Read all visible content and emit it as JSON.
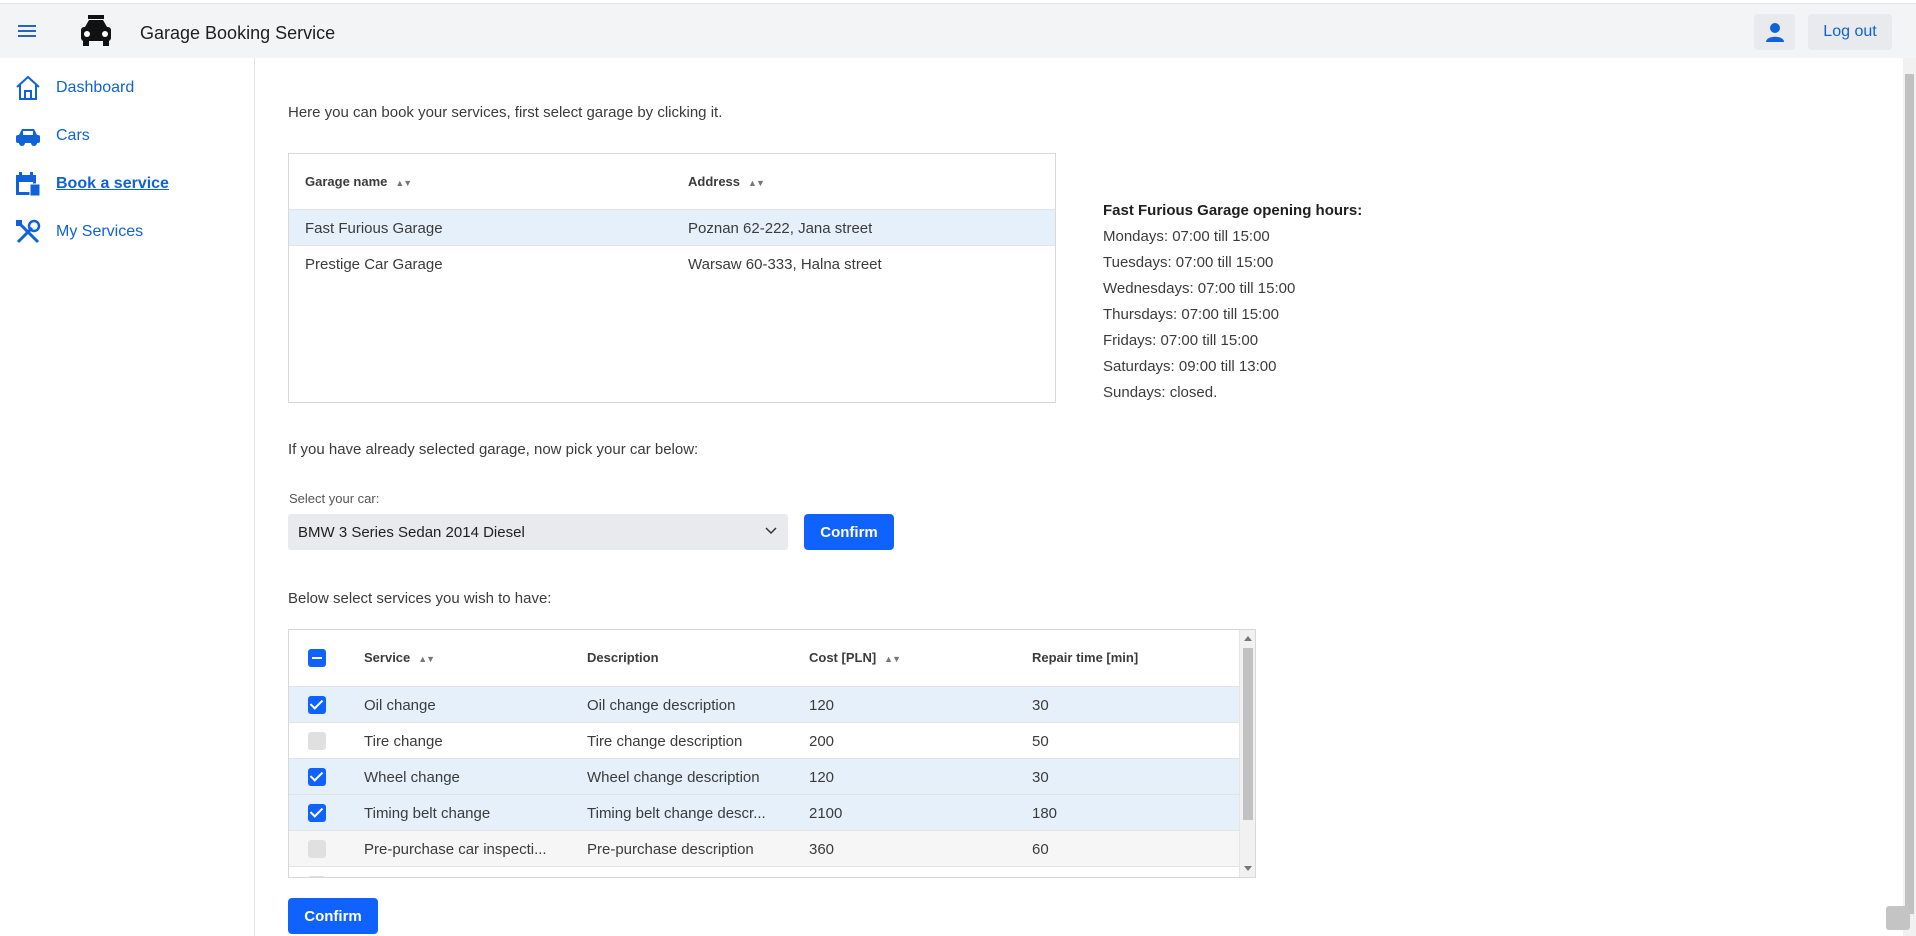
{
  "header": {
    "app_title": "Garage Booking Service",
    "logout_label": "Log out",
    "menu_icon": "hamburger-menu-icon",
    "logo_icon": "car-icon",
    "user_icon": "user-icon"
  },
  "sidebar": {
    "items": [
      {
        "label": "Dashboard",
        "icon": "home-icon",
        "active": false
      },
      {
        "label": "Cars",
        "icon": "car-icon",
        "active": false
      },
      {
        "label": "Book a service",
        "icon": "calendar-icon",
        "active": true
      },
      {
        "label": "My Services",
        "icon": "tools-icon",
        "active": false
      }
    ]
  },
  "main": {
    "intro_text": "Here you can book your services, first select garage by clicking it.",
    "garages": {
      "columns": [
        "Garage name",
        "Address"
      ],
      "rows": [
        {
          "name": "Fast Furious Garage",
          "address": "Poznan 62-222, Jana street",
          "selected": true
        },
        {
          "name": "Prestige Car Garage",
          "address": "Warsaw 60-333, Halna street",
          "selected": false
        }
      ]
    },
    "opening_hours": {
      "title": "Fast Furious Garage opening hours:",
      "lines": [
        "Mondays: 07:00 till 15:00",
        "Tuesdays: 07:00 till 15:00",
        "Wednesdays: 07:00 till 15:00",
        "Thursdays: 07:00 till 15:00",
        "Fridays: 07:00 till 15:00",
        "Saturdays: 09:00 till 13:00",
        "Sundays: closed."
      ]
    },
    "car_prompt": "If you have already selected garage, now pick your car below:",
    "car_select": {
      "label": "Select your car:",
      "value": "BMW 3 Series Sedan 2014 Diesel",
      "confirm_label": "Confirm"
    },
    "services_prompt": "Below select services you wish to have:",
    "services": {
      "columns": [
        "Service",
        "Description",
        "Cost [PLN]",
        "Repair time [min]"
      ],
      "rows": [
        {
          "service": "Oil change",
          "description": "Oil change description",
          "cost": "120",
          "time": "30",
          "checked": true
        },
        {
          "service": "Tire change",
          "description": "Tire change description",
          "cost": "200",
          "time": "50",
          "checked": false
        },
        {
          "service": "Wheel change",
          "description": "Wheel change description",
          "cost": "120",
          "time": "30",
          "checked": true
        },
        {
          "service": "Timing belt change",
          "description": "Timing belt change descr...",
          "cost": "2100",
          "time": "180",
          "checked": true
        },
        {
          "service": "Pre-purchase car inspecti...",
          "description": "Pre-purchase description",
          "cost": "360",
          "time": "60",
          "checked": false
        }
      ]
    },
    "confirm_label": "Confirm"
  },
  "colors": {
    "accent": "#0f62fe",
    "link": "#0f62d8",
    "selected_row": "#e6f0fb"
  }
}
